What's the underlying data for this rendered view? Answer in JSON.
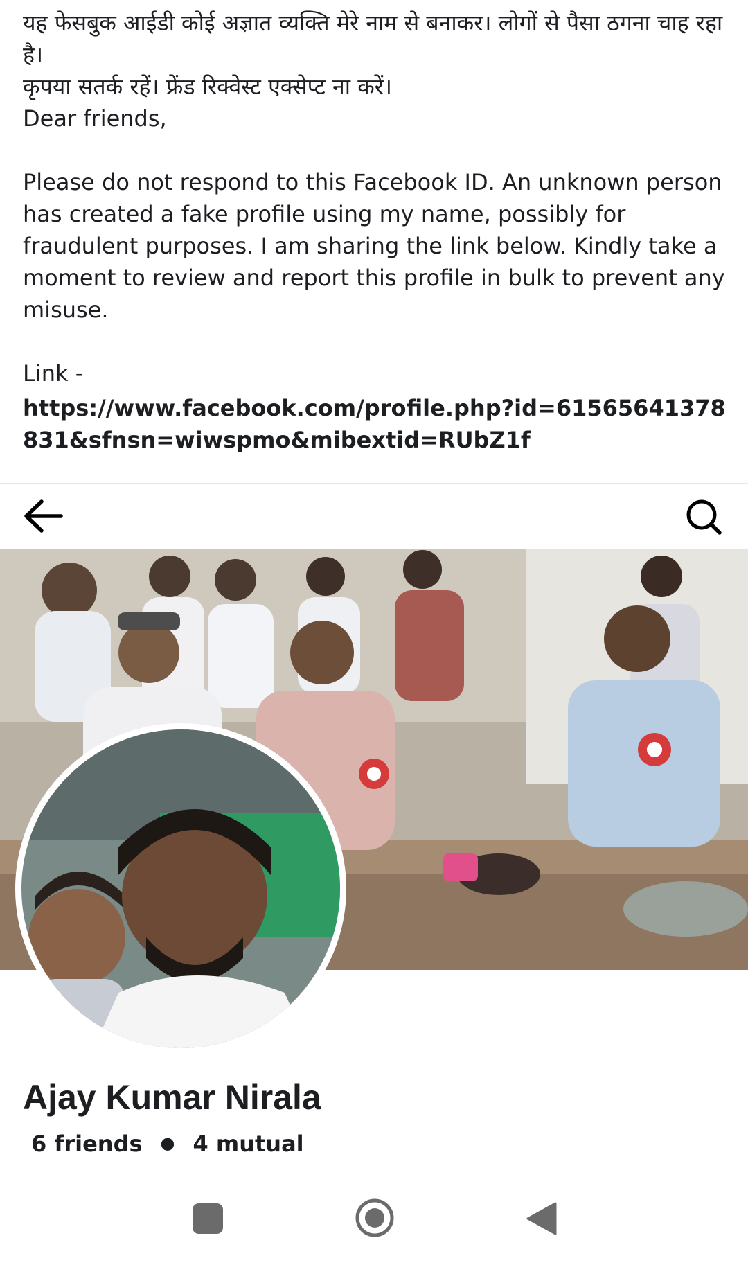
{
  "post": {
    "hindi_line1": "यह फेसबुक आईडी कोई अज्ञात व्यक्ति मेरे नाम से बनाकर। लोगों से पैसा ठगना चाह रहा है।",
    "hindi_line2": "कृपया सतर्क रहें। फ्रेंड रिक्वेस्ट एक्सेप्ट ना करें।",
    "greeting": "Dear friends,",
    "body": "Please do not respond to this Facebook ID. An unknown person has created a fake profile using my name, possibly for fraudulent purposes. I am sharing the link below. Kindly take a moment to review and report this profile in bulk to prevent any misuse.",
    "link_label": "Link -",
    "link_url": "https://www.facebook.com/profile.php?id=61565641378831&sfnsn=wiwspmo&mibextid=RUbZ1f"
  },
  "profile": {
    "name": "Ajay Kumar Nirala",
    "friends_count": "6 friends",
    "mutual_count": "4 mutual"
  },
  "icons": {
    "back": "back-arrow-icon",
    "search": "search-icon",
    "nav_recent": "recent-apps-icon",
    "nav_home": "home-icon",
    "nav_back": "nav-back-icon"
  },
  "colors": {
    "text": "#1c1e21",
    "nav_icon": "#6b6b6b"
  }
}
